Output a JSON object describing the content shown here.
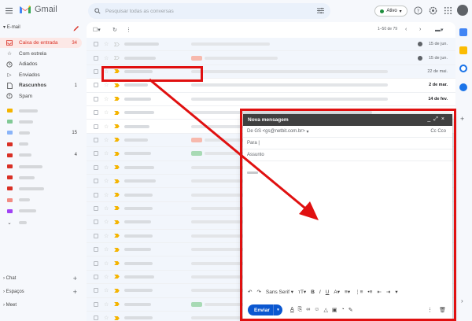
{
  "header": {
    "app_name": "Gmail",
    "search_placeholder": "Pesquisar todas as conversas",
    "status_label": "Ativo"
  },
  "sidebar": {
    "section_label": "E-mail",
    "items": [
      {
        "label": "Caixa de entrada",
        "count": "34",
        "active": true,
        "icon": "inbox-icon"
      },
      {
        "label": "Com estrela",
        "count": "",
        "icon": "star-icon"
      },
      {
        "label": "Adiados",
        "count": "",
        "icon": "clock-icon"
      },
      {
        "label": "Enviados",
        "count": "",
        "icon": "send-icon"
      },
      {
        "label": "Rascunhos",
        "count": "1",
        "icon": "draft-icon",
        "bold": true
      },
      {
        "label": "Spam",
        "count": "",
        "icon": "spam-icon"
      }
    ],
    "label_counts": [
      "",
      "",
      "15",
      "",
      "4",
      "",
      "",
      "",
      "",
      ""
    ],
    "label_colors": [
      "#f4b400",
      "#81c995",
      "#8ab4f8",
      "#d93025",
      "#d93025",
      "#d93025",
      "#d93025",
      "#d93025",
      "#f28b82",
      "#a142f4"
    ],
    "bottom": [
      "Chat",
      "Espaços",
      "Meet"
    ]
  },
  "toolbar": {
    "pagination": "1–50 de 79"
  },
  "emails": [
    {
      "date": "15 de jun.",
      "read": true,
      "clock": true,
      "chip": "",
      "important": false
    },
    {
      "date": "15 de jun.",
      "read": true,
      "clock": true,
      "chip": "red",
      "important": false
    },
    {
      "date": "22 de mai.",
      "read": true,
      "clock": false,
      "chip": "",
      "important": true
    },
    {
      "date": "2 de mar.",
      "read": false,
      "clock": false,
      "chip": "",
      "important": true
    },
    {
      "date": "14 de fev.",
      "read": false,
      "clock": false,
      "chip": "",
      "important": true
    },
    {
      "date": "",
      "read": false,
      "clock": false,
      "chip": "",
      "important": true
    },
    {
      "date": "",
      "read": false,
      "clock": false,
      "chip": "",
      "important": true
    },
    {
      "date": "",
      "read": true,
      "clock": false,
      "chip": "red",
      "important": true
    },
    {
      "date": "",
      "read": true,
      "clock": false,
      "chip": "green",
      "important": true
    },
    {
      "date": "",
      "read": true,
      "clock": false,
      "chip": "",
      "important": true
    },
    {
      "date": "",
      "read": true,
      "clock": false,
      "chip": "",
      "important": true
    },
    {
      "date": "",
      "read": true,
      "clock": false,
      "chip": "",
      "important": true
    },
    {
      "date": "",
      "read": true,
      "clock": false,
      "chip": "",
      "important": true
    },
    {
      "date": "",
      "read": true,
      "clock": false,
      "chip": "",
      "important": true
    },
    {
      "date": "",
      "read": true,
      "clock": false,
      "chip": "",
      "important": true
    },
    {
      "date": "",
      "read": true,
      "clock": false,
      "chip": "",
      "important": true
    },
    {
      "date": "",
      "read": true,
      "clock": false,
      "chip": "",
      "important": true
    },
    {
      "date": "",
      "read": true,
      "clock": false,
      "chip": "",
      "important": true
    },
    {
      "date": "",
      "read": true,
      "clock": false,
      "chip": "",
      "important": true
    },
    {
      "date": "",
      "read": true,
      "clock": false,
      "chip": "green",
      "important": true
    },
    {
      "date": "",
      "read": true,
      "clock": false,
      "chip": "",
      "important": true
    }
  ],
  "compose": {
    "title": "Nova mensagem",
    "from_label": "De",
    "from_value": "GS <gs@netbit.com.br>",
    "cc_label": "Cc Cco",
    "to_label": "Para",
    "subject_placeholder": "Assunto",
    "font_name": "Sans Serif",
    "send_label": "Enviar"
  },
  "colors": {
    "accent_red": "#d93025",
    "send_blue": "#0b57d0",
    "highlight": "#e01010"
  }
}
